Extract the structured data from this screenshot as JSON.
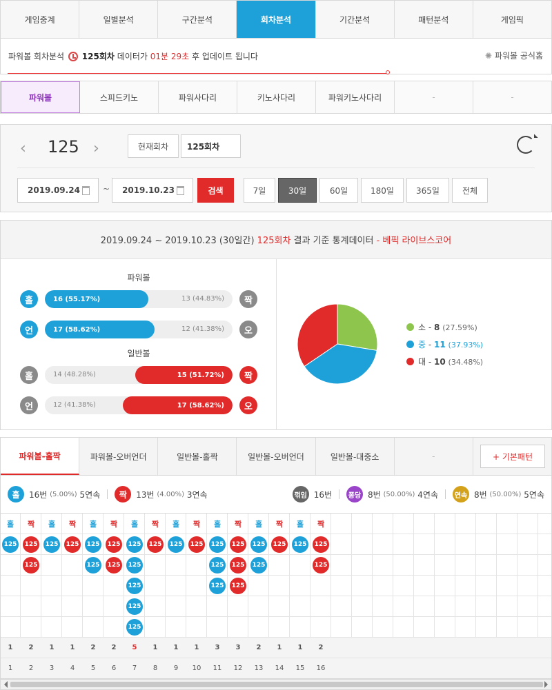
{
  "top_nav": [
    "게임중계",
    "일별분석",
    "구간분석",
    "회차분석",
    "기간분석",
    "패턴분석",
    "게임픽"
  ],
  "top_nav_active": 3,
  "info": {
    "prefix": "파워볼 회차분석",
    "round": "125회차",
    "middle": "데이터가",
    "time": "01분 29초",
    "suffix": "후 업데이트 됩니다",
    "home": "파워볼 공식홈"
  },
  "sub_games": [
    "파워볼",
    "스피드키노",
    "파워사다리",
    "키노사다리",
    "파워키노사다리",
    "-",
    "-"
  ],
  "round_panel": {
    "round": "125",
    "current_btn": "현재회차",
    "round_input": "125회차",
    "date_from": "2019.09.24",
    "date_to": "2019.10.23",
    "tilde": "~",
    "search": "검색",
    "periods": [
      "7일",
      "30일",
      "60일",
      "180일",
      "365일",
      "전체"
    ],
    "period_active": 1
  },
  "stats": {
    "header_plain": "2019.09.24 ~ 2019.10.23 (30일간)",
    "header_round": "125회차",
    "header_mid": "결과 기준 통계데이터",
    "header_source": "- 베픽 라이브스코어",
    "groups": [
      {
        "title": "파워볼"
      },
      {
        "title": "일반볼"
      }
    ],
    "bars": [
      {
        "left": "홀",
        "right": "짝",
        "left_value": "16 (55.17%)",
        "right_value": "13 (44.83%)",
        "left_fraction": 0.5517,
        "dominant": "left"
      },
      {
        "left": "언",
        "right": "오",
        "left_value": "17 (58.62%)",
        "right_value": "12 (41.38%)",
        "left_fraction": 0.5862,
        "dominant": "left"
      },
      {
        "left": "홀",
        "right": "짝",
        "left_value": "14 (48.28%)",
        "right_value": "15 (51.72%)",
        "left_fraction": 0.4828,
        "dominant": "right"
      },
      {
        "left": "언",
        "right": "오",
        "left_value": "12 (41.38%)",
        "right_value": "17 (58.62%)",
        "left_fraction": 0.4138,
        "dominant": "right"
      }
    ]
  },
  "chart_data": {
    "type": "pie",
    "slices": [
      {
        "label": "소",
        "value": 8,
        "percent": "(27.59%)",
        "color": "#8dc54d"
      },
      {
        "label": "중",
        "value": 11,
        "percent": "(37.93%)",
        "color": "#1ea1d8"
      },
      {
        "label": "대",
        "value": 10,
        "percent": "(34.48%)",
        "color": "#e12b2b"
      }
    ]
  },
  "pattern_tabs": [
    "파워볼-홀짝",
    "파워볼-오버언더",
    "일반볼-홀짝",
    "일반볼-오버언더",
    "일반볼-대중소",
    "-"
  ],
  "basic_pattern": "+ 기본패턴",
  "legend": {
    "odd": {
      "icon": "홀",
      "text": "16번",
      "pct": "(5.00%)",
      "streak": "5연속"
    },
    "even": {
      "icon": "짝",
      "text": "13번",
      "pct": "(4.00%)",
      "streak": "3연속"
    },
    "bend": {
      "icon": "꺾임",
      "text": "16번"
    },
    "pong": {
      "icon": "퐁당",
      "text": "8번",
      "pct": "(50.00%)",
      "streak": "4연속"
    },
    "cont": {
      "icon": "연속",
      "text": "8번",
      "pct": "(50.00%)",
      "streak": "5연속"
    }
  },
  "columns": [
    {
      "type": "홀",
      "count": 1,
      "index": "1"
    },
    {
      "type": "짝",
      "count": 2,
      "index": "2"
    },
    {
      "type": "홀",
      "count": 1,
      "index": "3"
    },
    {
      "type": "짝",
      "count": 1,
      "index": "4"
    },
    {
      "type": "홀",
      "count": 2,
      "index": "5"
    },
    {
      "type": "짝",
      "count": 2,
      "index": "6"
    },
    {
      "type": "홀",
      "count": 5,
      "index": "7"
    },
    {
      "type": "짝",
      "count": 1,
      "index": "8"
    },
    {
      "type": "홀",
      "count": 1,
      "index": "9"
    },
    {
      "type": "짝",
      "count": 1,
      "index": "10"
    },
    {
      "type": "홀",
      "count": 3,
      "index": "11"
    },
    {
      "type": "짝",
      "count": 3,
      "index": "12"
    },
    {
      "type": "홀",
      "count": 2,
      "index": "13"
    },
    {
      "type": "짝",
      "count": 1,
      "index": "14"
    },
    {
      "type": "홀",
      "count": 1,
      "index": "15"
    },
    {
      "type": "짝",
      "count": 2,
      "index": "16"
    }
  ],
  "ball_label": "125",
  "colors": {
    "blue": "#1ea1d8",
    "red": "#e12b2b",
    "purple": "#8a33b8",
    "gold": "#d4a21a",
    "dark": "#666666"
  }
}
